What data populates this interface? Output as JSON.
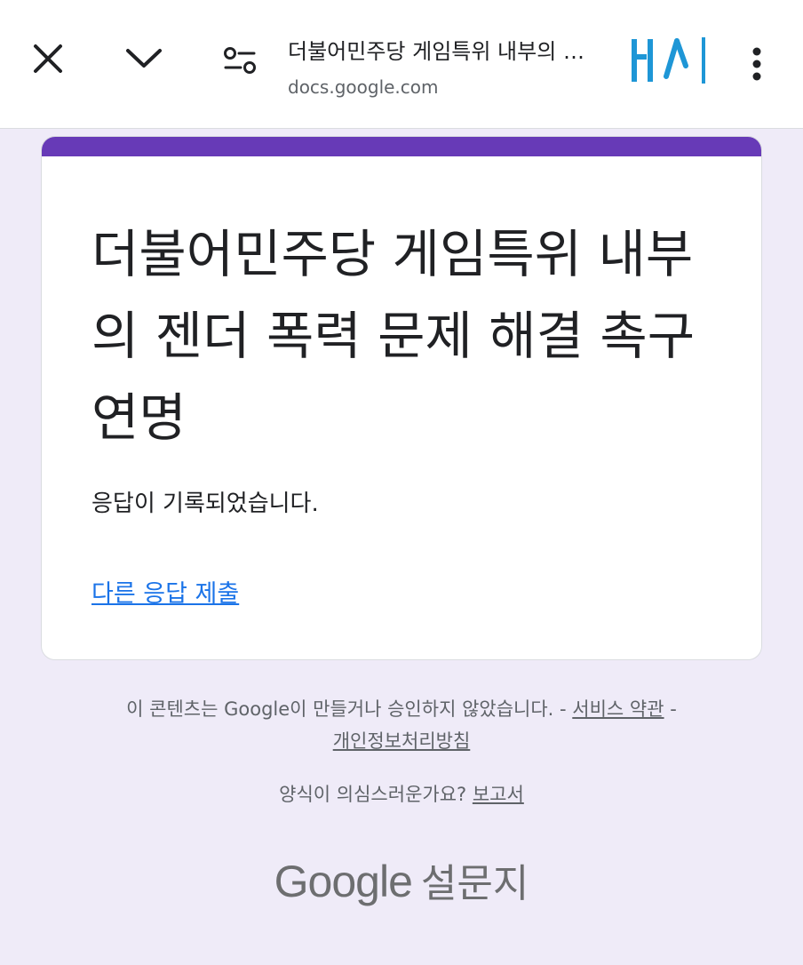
{
  "browser": {
    "title": "더불어민주당 게임특위 내부의 젠더 폭력 문제 해결 촉구 연명",
    "url": "docs.google.com",
    "icons": {
      "close": "close-icon",
      "chevron": "chevron-down-icon",
      "tune": "tune-icon",
      "menu": "more-vert-icon",
      "logo": "brand-logo"
    }
  },
  "form": {
    "title": "더불어민주당 게임특위 내부의 젠더 폭력 문제 해결 촉구 연명",
    "confirmation": "응답이 기록되었습니다.",
    "another_response_link": "다른 응답 제출"
  },
  "footer": {
    "disclaimer": "이 콘텐츠는 Google이 만들거나 승인하지 않았습니다.",
    "sep1": " - ",
    "terms_link": "서비스 약관",
    "sep2": " - ",
    "privacy_link": "개인정보처리방침",
    "suspicious_question": "양식이 의심스러운가요? ",
    "report_link": "보고서",
    "logo_google": "Google",
    "logo_forms": "설문지"
  },
  "colors": {
    "accent": "#673ab7",
    "link": "#1a73e8",
    "background": "#efebf8",
    "logo_blue": "#1e96d6"
  }
}
